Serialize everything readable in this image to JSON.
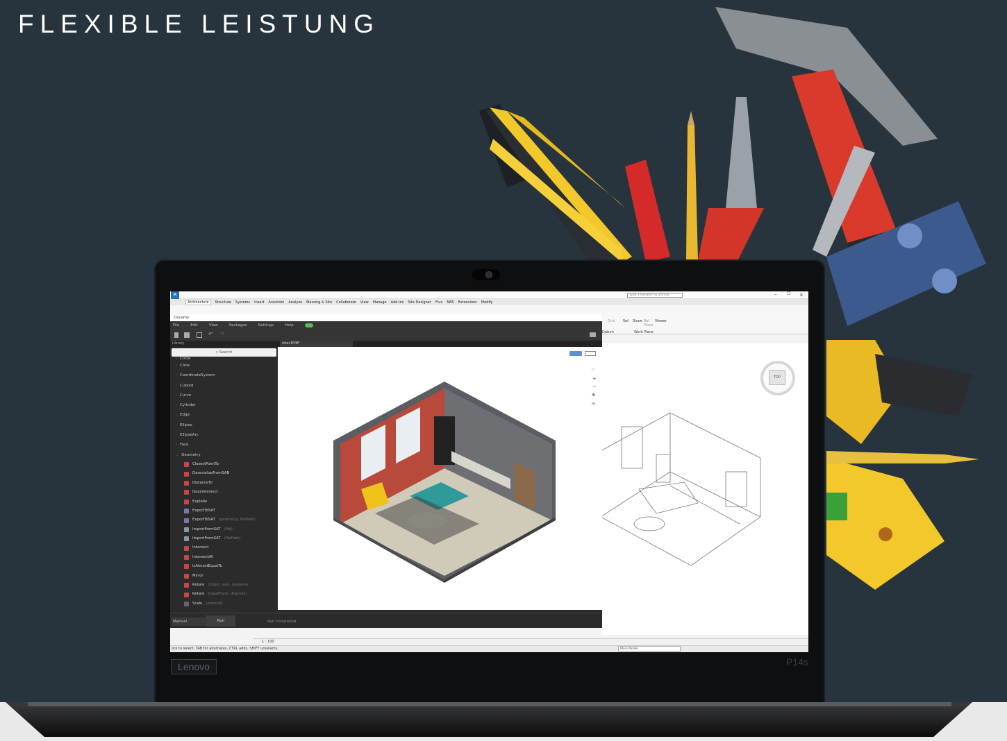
{
  "headline": "FLEXIBLE LEISTUNG",
  "laptop": {
    "brand": "Lenovo",
    "model": "P14s"
  },
  "revit": {
    "search_placeholder": "Type a keyword or phrase",
    "tabs": [
      "Architecture",
      "Structure",
      "Systems",
      "Insert",
      "Annotate",
      "Analyze",
      "Massing & Site",
      "Collaborate",
      "View",
      "Manage",
      "Add-Ins",
      "Site Designer",
      "Flux",
      "NBS",
      "Extensions",
      "Modify"
    ],
    "ribbon": {
      "set": "Set",
      "show": "Show",
      "ref_plane": "Ref Plane",
      "viewer": "Viewer",
      "grid": "Grid",
      "datum": "Datum",
      "work_plane": "Work Plane"
    },
    "viewcube_top": "TOP",
    "scale": "1 : 100",
    "status": "lick to select, TAB for alternates, CTRL adds, SHIFT unselects.",
    "main_model": "Main Model"
  },
  "dynamo": {
    "title": "Dynamo",
    "menu": [
      "File",
      "Edit",
      "View",
      "Packages",
      "Settings",
      "Help"
    ],
    "library_label": "Library",
    "file_tab": "inter.DYN*",
    "search_placeholder": "Search",
    "categories": [
      "Circle",
      "Cone",
      "CoordinateSystem",
      "Cuboid",
      "Curve",
      "Cylinder",
      "Edge",
      "Ellipse",
      "EllipseArc",
      "Face",
      "Geometry"
    ],
    "geometry_nodes": [
      {
        "name": "ClosestPointTo",
        "params": ""
      },
      {
        "name": "DeserializeFromSAB",
        "params": ""
      },
      {
        "name": "DistanceTo",
        "params": ""
      },
      {
        "name": "DoesIntersect",
        "params": ""
      },
      {
        "name": "Explode",
        "params": ""
      },
      {
        "name": "ExportToSAT",
        "params": ""
      },
      {
        "name": "ExportToSAT",
        "params": "(geometry, filePath)"
      },
      {
        "name": "ImportFromSAT",
        "params": "(file)"
      },
      {
        "name": "ImportFromSAT",
        "params": "(filePath)"
      },
      {
        "name": "Intersect",
        "params": ""
      },
      {
        "name": "IntersectAll",
        "params": ""
      },
      {
        "name": "IsAlmostEqualTo",
        "params": ""
      },
      {
        "name": "Mirror",
        "params": ""
      },
      {
        "name": "Rotate",
        "params": "(origin, axis, degrees)"
      },
      {
        "name": "Rotate",
        "params": "(basePlane, degrees)"
      },
      {
        "name": "Scale",
        "params": "(amount)"
      }
    ],
    "run_mode": "Manual",
    "run_label": "Run",
    "run_status": "Run completed."
  }
}
